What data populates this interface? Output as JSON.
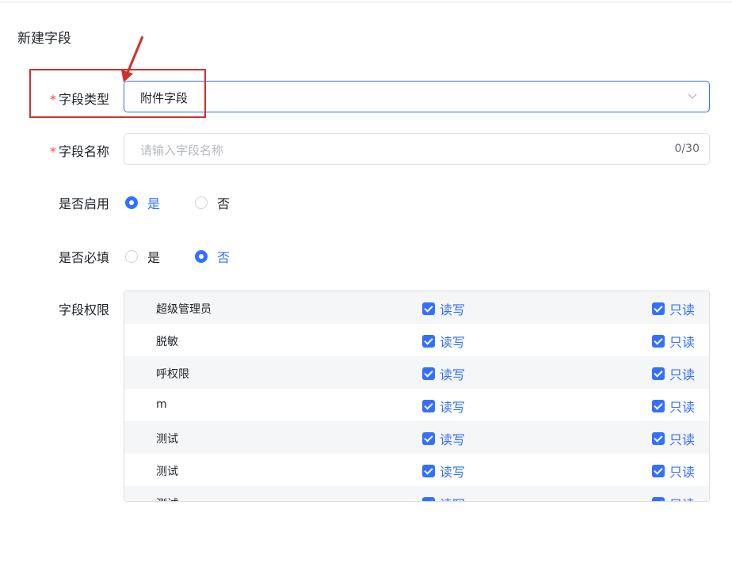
{
  "page": {
    "title": "新建字段"
  },
  "form": {
    "field_type": {
      "label": "字段类型",
      "required_mark": "*",
      "value": "附件字段"
    },
    "field_name": {
      "label": "字段名称",
      "required_mark": "*",
      "placeholder": "请输入字段名称",
      "counter": "0/30"
    },
    "enabled": {
      "label": "是否启用",
      "yes": "是",
      "no": "否",
      "selected": "是"
    },
    "required": {
      "label": "是否必填",
      "yes": "是",
      "no": "否",
      "selected": "否"
    },
    "permissions": {
      "label": "字段权限",
      "read_write_label": "读写",
      "read_only_label": "只读",
      "rows": [
        {
          "role": "超级管理员",
          "read_write": true,
          "read_only": true
        },
        {
          "role": "脱敏",
          "read_write": true,
          "read_only": true
        },
        {
          "role": "呼权限",
          "read_write": true,
          "read_only": true
        },
        {
          "role": "m",
          "read_write": true,
          "read_only": true
        },
        {
          "role": "测试",
          "read_write": true,
          "read_only": true
        },
        {
          "role": "测试",
          "read_write": true,
          "read_only": true
        },
        {
          "role": "测试",
          "read_write": true,
          "read_only": true
        }
      ]
    }
  },
  "colors": {
    "accent": "#3370ff",
    "required": "#f54a45",
    "annotation": "#d0312d"
  },
  "icons": {
    "select_arrow": "chevron-down-icon",
    "annotation_arrow": "arrow-icon"
  }
}
